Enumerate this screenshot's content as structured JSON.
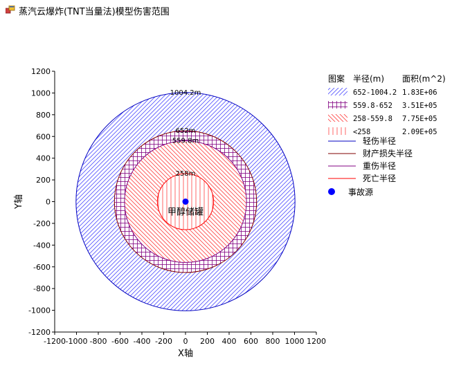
{
  "window": {
    "title": "蒸汽云爆炸(TNT当量法)模型伤害范围",
    "icon": "app-window-icon"
  },
  "chart_data": {
    "type": "contour-circles",
    "xlabel": "X轴",
    "ylabel": "Y轴",
    "xlim": [
      -1200,
      1200
    ],
    "ylim": [
      -1200,
      1200
    ],
    "ticks": [
      -1200,
      -1000,
      -800,
      -600,
      -400,
      -200,
      0,
      200,
      400,
      600,
      800,
      1000,
      1200
    ],
    "grid": false,
    "source": {
      "x": 0,
      "y": 0,
      "label": "甲醇储罐",
      "color": "#0000ff"
    },
    "radius_labels": [
      {
        "r": 1004.2,
        "text": "1004.2m"
      },
      {
        "r": 652,
        "text": "652m"
      },
      {
        "r": 559.8,
        "text": "559.8m"
      },
      {
        "r": 258,
        "text": "258m"
      }
    ],
    "zones": [
      {
        "inner": 652,
        "outer": 1004.2,
        "pattern": "diag-blue",
        "color": "#5050ff",
        "radius_range": "652-1004.2",
        "area": "1.83E+06"
      },
      {
        "inner": 559.8,
        "outer": 652,
        "pattern": "grid-purple",
        "color": "#800080",
        "radius_range": "559.8-652",
        "area": "3.51E+05"
      },
      {
        "inner": 258,
        "outer": 559.8,
        "pattern": "diag-red",
        "color": "#ff4040",
        "radius_range": "258-559.8",
        "area": "7.75E+05"
      },
      {
        "inner": 0,
        "outer": 258,
        "pattern": "vert-red",
        "color": "#ff4040",
        "radius_range": "<258",
        "area": "2.09E+05"
      }
    ],
    "circles": [
      {
        "r": 1004.2,
        "color": "#0000c0",
        "name": "轻伤半径"
      },
      {
        "r": 652,
        "color": "#800000",
        "name": "财产损失半径"
      },
      {
        "r": 559.8,
        "color": "#800080",
        "name": "重伤半径"
      },
      {
        "r": 258,
        "color": "#ff0000",
        "name": "死亡半径"
      }
    ],
    "legend": {
      "placement": "right",
      "header": [
        "图案",
        "半径(m)",
        "面积(m^2)"
      ],
      "source_label": "事故源"
    }
  }
}
